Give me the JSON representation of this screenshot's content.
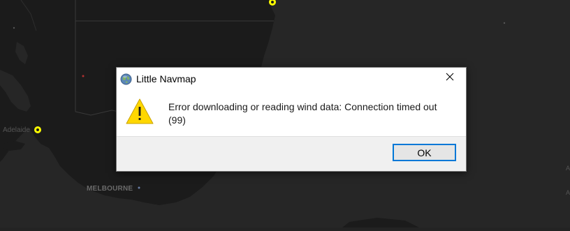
{
  "map": {
    "labels": {
      "adelaide": "Adelaide",
      "melbourne": "MELBOURNE",
      "edge_a": "A",
      "edge_a2": "A"
    },
    "colors": {
      "background": "#232323",
      "land": "#1a1a1a",
      "airport_marker": "#ffff00"
    }
  },
  "dialog": {
    "title": "Little Navmap",
    "app_icon": "globe-icon",
    "close_icon": "close-icon",
    "severity_icon": "warning-icon",
    "message": "Error downloading or reading wind data: Connection timed out (99)",
    "ok_label": "OK",
    "colors": {
      "focus_border": "#0078d7",
      "warning_fill": "#ffd700",
      "footer_bg": "#f0f0f0"
    }
  }
}
